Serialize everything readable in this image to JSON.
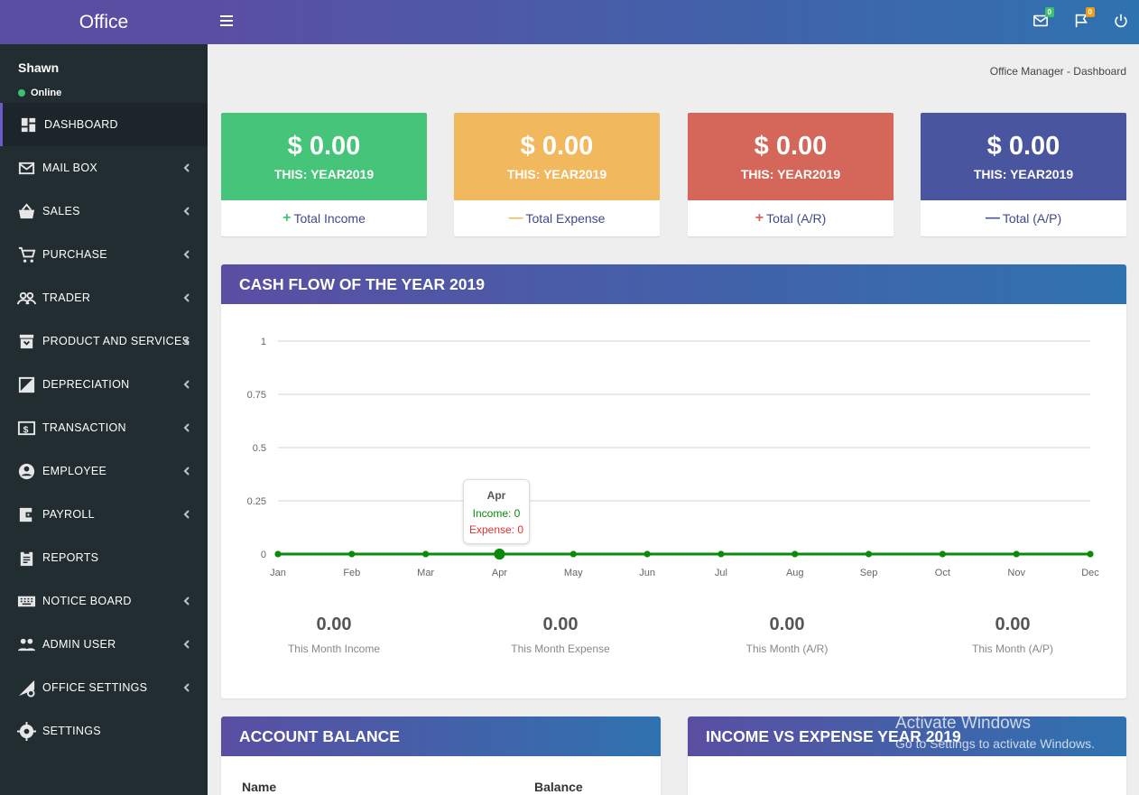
{
  "brand": "Office",
  "user": {
    "name": "Shawn",
    "status": "Online"
  },
  "menu": [
    {
      "label": "DASHBOARD",
      "icon": "dashboard-icon",
      "chevron": false
    },
    {
      "label": "MAIL BOX",
      "icon": "mail-icon",
      "chevron": true
    },
    {
      "label": "SALES",
      "icon": "basket-icon",
      "chevron": true
    },
    {
      "label": "PURCHASE",
      "icon": "cart-icon",
      "chevron": true
    },
    {
      "label": "TRADER",
      "icon": "people-icon",
      "chevron": true
    },
    {
      "label": "PRODUCT AND SERVICES",
      "icon": "archive-icon",
      "chevron": true
    },
    {
      "label": "DEPRECIATION",
      "icon": "depreciation-icon",
      "chevron": true
    },
    {
      "label": "TRANSACTION",
      "icon": "dollar-icon",
      "chevron": true
    },
    {
      "label": "EMPLOYEE",
      "icon": "account-icon",
      "chevron": true
    },
    {
      "label": "PAYROLL",
      "icon": "wallet-icon",
      "chevron": true
    },
    {
      "label": "REPORTS",
      "icon": "clipboard-icon",
      "chevron": false
    },
    {
      "label": "NOTICE BOARD",
      "icon": "keyboard-icon",
      "chevron": true
    },
    {
      "label": "ADMIN USER",
      "icon": "group-icon",
      "chevron": true
    },
    {
      "label": "OFFICE SETTINGS",
      "icon": "network-settings-icon",
      "chevron": true
    },
    {
      "label": "SETTINGS",
      "icon": "gear-icon",
      "chevron": false
    }
  ],
  "topbar": {
    "mail_count": "0",
    "flag_count": "0"
  },
  "breadcrumb": "Office Manager - Dashboard",
  "cards": [
    {
      "amount": "$ 0.00",
      "period": "THIS: YEAR2019",
      "symbol": "+",
      "label": "Total Income",
      "color": "#46c47a",
      "symbol_color": "#46c47a"
    },
    {
      "amount": "$ 0.00",
      "period": "THIS: YEAR2019",
      "symbol": "—",
      "label": "Total Expense",
      "color": "#f2b85e",
      "symbol_color": "#f2b85e"
    },
    {
      "amount": "$ 0.00",
      "period": "THIS: YEAR2019",
      "symbol": "+",
      "label": "Total (A/R)",
      "color": "#d4665a",
      "symbol_color": "#d4665a"
    },
    {
      "amount": "$ 0.00",
      "period": "THIS: YEAR2019",
      "symbol": "—",
      "label": "Total (A/P)",
      "color": "#4a55a0",
      "symbol_color": "#4a55a0"
    }
  ],
  "cashflow": {
    "title": "CASH FLOW OF THE YEAR 2019",
    "tooltip": {
      "month": "Apr",
      "income": "Income: 0",
      "expense": "Expense: 0"
    },
    "stats": [
      {
        "value": "0.00",
        "label": "This Month Income"
      },
      {
        "value": "0.00",
        "label": "This Month Expense"
      },
      {
        "value": "0.00",
        "label": "This Month (A/R)"
      },
      {
        "value": "0.00",
        "label": "This Month (A/P)"
      }
    ]
  },
  "account_balance": {
    "title": "ACCOUNT BALANCE",
    "col_name": "Name",
    "col_balance": "Balance"
  },
  "income_vs_expense": {
    "title": "INCOME VS EXPENSE YEAR 2019"
  },
  "watermark": {
    "line1": "Activate Windows",
    "line2": "Go to Settings to activate Windows."
  },
  "chart_data": {
    "type": "line",
    "categories": [
      "Jan",
      "Feb",
      "Mar",
      "Apr",
      "May",
      "Jun",
      "Jul",
      "Aug",
      "Sep",
      "Oct",
      "Nov",
      "Dec"
    ],
    "series": [
      {
        "name": "Income",
        "values": [
          0,
          0,
          0,
          0,
          0,
          0,
          0,
          0,
          0,
          0,
          0,
          0
        ],
        "color": "#0a8a0a"
      },
      {
        "name": "Expense",
        "values": [
          0,
          0,
          0,
          0,
          0,
          0,
          0,
          0,
          0,
          0,
          0,
          0
        ],
        "color": "#e53030"
      }
    ],
    "yticks": [
      0,
      0.25,
      0.5,
      0.75,
      1
    ],
    "ylim": [
      0,
      1
    ],
    "grid": true,
    "highlight": "Apr"
  }
}
